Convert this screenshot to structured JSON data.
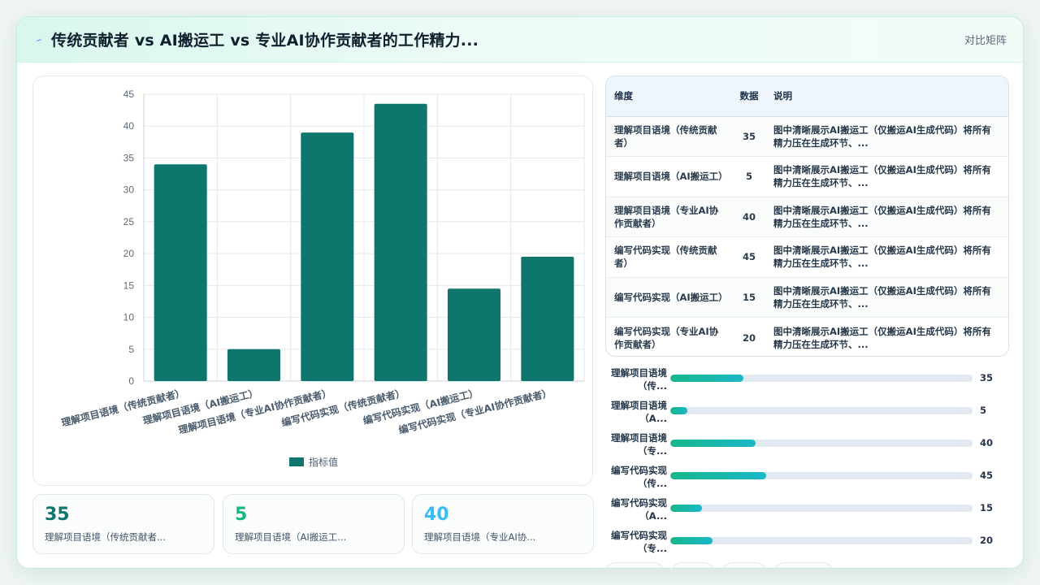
{
  "header": {
    "title": "传统贡献者 vs AI搬运工 vs 专业AI协作贡献者的工作精力...",
    "badge": "对比矩阵"
  },
  "colors": {
    "bar": "#0f766e",
    "accent_green": "#10b981",
    "accent_blue": "#38bdf8"
  },
  "chart_data": {
    "type": "bar",
    "categories": [
      "理解项目语境（传统贡献者）",
      "理解项目语境（AI搬运工）",
      "理解项目语境（专业AI协作贡献者）",
      "编写代码实现（传统贡献者）",
      "编写代码实现（AI搬运工）",
      "编写代码实现（专业AI协作贡献者）"
    ],
    "series": [
      {
        "name": "指标值",
        "values": [
          34,
          5,
          39,
          43.5,
          14.5,
          19.5
        ]
      }
    ],
    "yticks": [
      "0",
      "5",
      "10",
      "15",
      "20",
      "25",
      "30",
      "35",
      "40",
      "45"
    ],
    "ylim": [
      0,
      45
    ],
    "legend": "bottom",
    "grid": true
  },
  "kpis": [
    {
      "value": "35",
      "label": "理解项目语境（传统贡献者..."
    },
    {
      "value": "5",
      "label": "理解项目语境（AI搬运工..."
    },
    {
      "value": "40",
      "label": "理解项目语境（专业AI协..."
    }
  ],
  "table": {
    "headers": [
      "维度",
      "数据",
      "说明"
    ],
    "rows": [
      {
        "dim": "理解项目语境（传统贡献者）",
        "num": "35",
        "desc": "图中清晰展示AI搬运工（仅搬运AI生成代码）将所有精力压在生成环节、..."
      },
      {
        "dim": "理解项目语境（AI搬运工）",
        "num": "5",
        "desc": "图中清晰展示AI搬运工（仅搬运AI生成代码）将所有精力压在生成环节、..."
      },
      {
        "dim": "理解项目语境（专业AI协作贡献者）",
        "num": "40",
        "desc": "图中清晰展示AI搬运工（仅搬运AI生成代码）将所有精力压在生成环节、..."
      },
      {
        "dim": "编写代码实现（传统贡献者）",
        "num": "45",
        "desc": "图中清晰展示AI搬运工（仅搬运AI生成代码）将所有精力压在生成环节、..."
      },
      {
        "dim": "编写代码实现（AI搬运工）",
        "num": "15",
        "desc": "图中清晰展示AI搬运工（仅搬运AI生成代码）将所有精力压在生成环节、..."
      },
      {
        "dim": "编写代码实现（专业AI协作贡献者）",
        "num": "20",
        "desc": "图中清晰展示AI搬运工（仅搬运AI生成代码）将所有精力压在生成环节、..."
      }
    ]
  },
  "progress": [
    {
      "label": "理解项目语境（传...",
      "value": "35",
      "fraction": 0.243
    },
    {
      "label": "理解项目语境（A...",
      "value": "5",
      "fraction": 0.056
    },
    {
      "label": "理解项目语境（专...",
      "value": "40",
      "fraction": 0.281
    },
    {
      "label": "编写代码实现（传...",
      "value": "45",
      "fraction": 0.317
    },
    {
      "label": "编写代码实现（A...",
      "value": "15",
      "fraction": 0.105
    },
    {
      "label": "编写代码实现（专...",
      "value": "20",
      "fraction": 0.141
    }
  ]
}
